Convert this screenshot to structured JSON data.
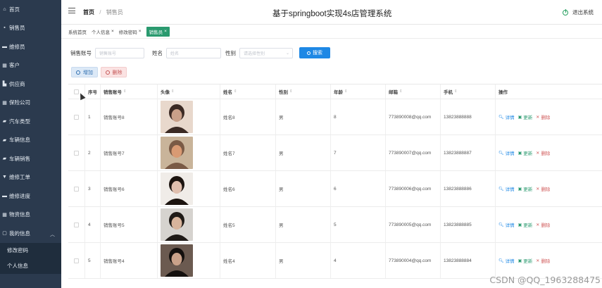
{
  "sidebar": {
    "items": [
      {
        "label": "首页",
        "icon": "home-icon"
      },
      {
        "label": "销售员",
        "icon": "user-icon"
      },
      {
        "label": "维修员",
        "icon": "wrench-icon"
      },
      {
        "label": "客户",
        "icon": "grid-icon"
      },
      {
        "label": "供应商",
        "icon": "truck-icon"
      },
      {
        "label": "保险公司",
        "icon": "shield-icon"
      },
      {
        "label": "汽车类型",
        "icon": "car-icon"
      },
      {
        "label": "车辆信息",
        "icon": "car-icon"
      },
      {
        "label": "车辆销售",
        "icon": "car-icon"
      },
      {
        "label": "维修工单",
        "icon": "ticket-icon"
      },
      {
        "label": "维修进度",
        "icon": "progress-icon"
      },
      {
        "label": "物资信息",
        "icon": "grid-icon"
      },
      {
        "label": "我的信息",
        "icon": "profile-icon",
        "expanded": true
      }
    ],
    "sub_items": [
      {
        "label": "修改密码"
      },
      {
        "label": "个人信息"
      }
    ]
  },
  "header": {
    "home": "首页",
    "separator": "/",
    "current": "销售员",
    "title": "基于springboot实现4s店管理系统",
    "logout": "退出系统"
  },
  "tabs": [
    {
      "label": "系统首页",
      "closable": false,
      "active": false
    },
    {
      "label": "个人信息",
      "closable": true,
      "active": false
    },
    {
      "label": "修改密码",
      "closable": true,
      "active": false
    },
    {
      "label": "销售员",
      "closable": true,
      "active": true
    }
  ],
  "search": {
    "account_label": "销售账号",
    "account_placeholder": "销售账号",
    "name_label": "姓名",
    "name_placeholder": "姓名",
    "gender_label": "性别",
    "gender_placeholder": "请选择性别",
    "button": "搜索"
  },
  "actions": {
    "add": "增加",
    "delete": "删除"
  },
  "table": {
    "headers": [
      "序号",
      "销售账号",
      "头像",
      "姓名",
      "性别",
      "年龄",
      "邮箱",
      "手机",
      "操作"
    ],
    "op_labels": {
      "detail": "详情",
      "update": "更新",
      "remove": "删除"
    },
    "rows": [
      {
        "index": "1",
        "account": "销售账号8",
        "name": "姓名8",
        "gender": "男",
        "age": "8",
        "email": "773890008@qq.com",
        "phone": "13823888888"
      },
      {
        "index": "2",
        "account": "销售账号7",
        "name": "姓名7",
        "gender": "男",
        "age": "7",
        "email": "773890007@qq.com",
        "phone": "13823888887"
      },
      {
        "index": "3",
        "account": "销售账号6",
        "name": "姓名6",
        "gender": "男",
        "age": "6",
        "email": "773890006@qq.com",
        "phone": "13823888886"
      },
      {
        "index": "4",
        "account": "销售账号5",
        "name": "姓名5",
        "gender": "男",
        "age": "5",
        "email": "773890005@qq.com",
        "phone": "13823888885"
      },
      {
        "index": "5",
        "account": "销售账号4",
        "name": "姓名4",
        "gender": "男",
        "age": "4",
        "email": "773890004@qq.com",
        "phone": "13823888884"
      }
    ]
  },
  "watermark": "CSDN @QQ_1963288475",
  "colors": {
    "sidebar_bg": "#2b3a4e",
    "accent_green": "#2a9a6f",
    "primary_blue": "#1e88e5",
    "danger_red": "#d05a5a"
  }
}
